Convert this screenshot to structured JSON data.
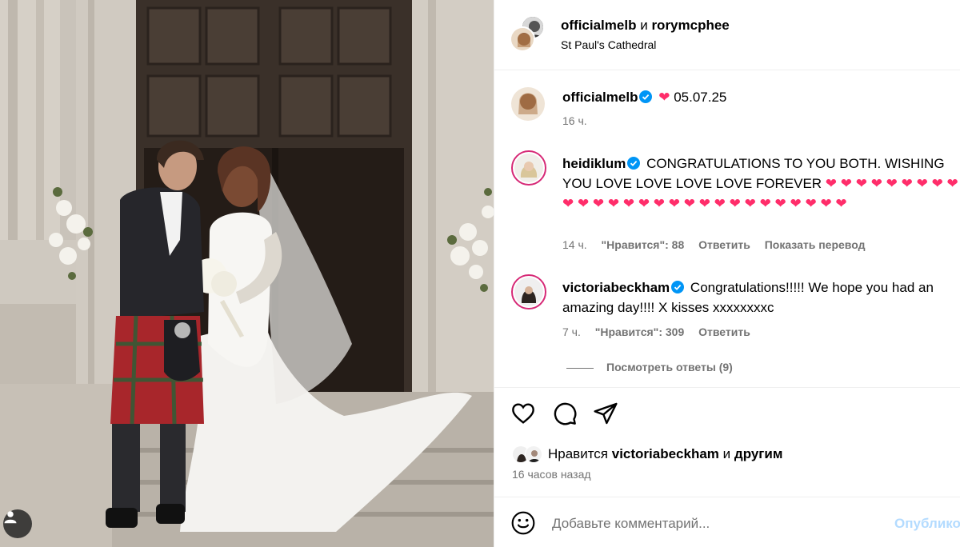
{
  "header": {
    "user1": "officialmelb",
    "and": "и",
    "user2": "rorymcphee",
    "location": "St Paul's Cathedral"
  },
  "caption": {
    "username": "officialmelb",
    "heart": "❤",
    "text": "05.07.25",
    "time": "16 ч."
  },
  "comments": [
    {
      "username": "heidiklum",
      "text": "CONGRATULATIONS TO YOU BOTH. WISHING YOU LOVE LOVE LOVE LOVE FOREVER",
      "hearts": "❤ ❤ ❤ ❤ ❤ ❤ ❤ ❤ ❤ ❤ ❤ ❤ ❤ ❤ ❤ ❤ ❤ ❤ ❤ ❤ ❤ ❤ ❤ ❤ ❤ ❤ ❤ ❤",
      "time": "14 ч.",
      "likes": "\"Нравится\": 88",
      "reply": "Ответить",
      "translate": "Показать перевод"
    },
    {
      "username": "victoriabeckham",
      "text": "Congratulations!!!!! We hope you had an amazing day!!!! X kisses xxxxxxxxc",
      "time": "7 ч.",
      "likes": "\"Нравится\": 309",
      "reply": "Ответить"
    }
  ],
  "view_replies": "Посмотреть ответы (9)",
  "likes_line": {
    "prefix": "Нравится",
    "user": "victoriabeckham",
    "and": "и",
    "others": "другим"
  },
  "posted_time": "16 часов назад",
  "add_comment": {
    "placeholder": "Добавьте комментарий...",
    "post_label": "Опублико"
  },
  "icons": {
    "like": "heart-outline-icon",
    "comment": "comment-bubble-icon",
    "share": "paper-plane-icon",
    "emoji": "smiley-icon",
    "tag": "user-tag-icon",
    "verified": "verified-badge-icon"
  },
  "colors": {
    "heart": "#ff2d6a",
    "verified": "#0095f6",
    "secondary_text": "#737373",
    "post_disabled": "#b3dbff"
  }
}
